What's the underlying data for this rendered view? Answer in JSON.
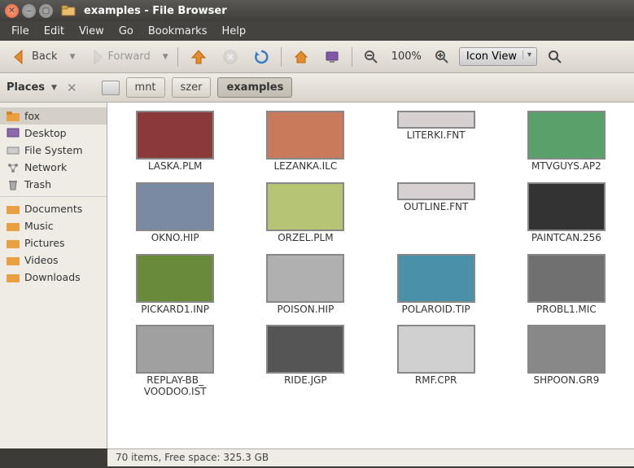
{
  "window": {
    "title": "examples - File Browser"
  },
  "menu": {
    "file": "File",
    "edit": "Edit",
    "view": "View",
    "go": "Go",
    "bookmarks": "Bookmarks",
    "help": "Help"
  },
  "toolbar": {
    "back": "Back",
    "forward": "Forward",
    "zoom": "100%",
    "view_mode": "Icon View"
  },
  "places_label": "Places",
  "path": {
    "seg0": "mnt",
    "seg1": "szer",
    "seg2": "examples"
  },
  "sidebar": {
    "items": [
      {
        "label": "fox"
      },
      {
        "label": "Desktop"
      },
      {
        "label": "File System"
      },
      {
        "label": "Network"
      },
      {
        "label": "Trash"
      },
      {
        "label": "Documents"
      },
      {
        "label": "Music"
      },
      {
        "label": "Pictures"
      },
      {
        "label": "Videos"
      },
      {
        "label": "Downloads"
      }
    ]
  },
  "files": [
    {
      "name": "LASKA.PLM"
    },
    {
      "name": "LEZANKA.ILC"
    },
    {
      "name": "LITERKI.FNT",
      "small": true
    },
    {
      "name": "MTVGUYS.AP2"
    },
    {
      "name": "OKNO.HIP"
    },
    {
      "name": "ORZEL.PLM"
    },
    {
      "name": "OUTLINE.FNT",
      "small": true
    },
    {
      "name": "PAINTCAN.256"
    },
    {
      "name": "PICKARD1.INP"
    },
    {
      "name": "POISON.HIP"
    },
    {
      "name": "POLAROID.TIP"
    },
    {
      "name": "PROBL1.MIC"
    },
    {
      "name": "REPLAY-BB_ VOODOO.IST"
    },
    {
      "name": "RIDE.JGP"
    },
    {
      "name": "RMF.CPR"
    },
    {
      "name": "SHPOON.GR9"
    }
  ],
  "status": "70 items, Free space: 325.3 GB",
  "thumb_colors": [
    "#8b3a3a",
    "#c97a5a",
    "#d6d0d0",
    "#5aa06a",
    "#7a8aa2",
    "#b6c476",
    "#d6d0d0",
    "#333",
    "#688a3a",
    "#b0b0b0",
    "#4a90a8",
    "#707070",
    "#a0a0a0",
    "#555",
    "#d0d0d0",
    "#888"
  ]
}
